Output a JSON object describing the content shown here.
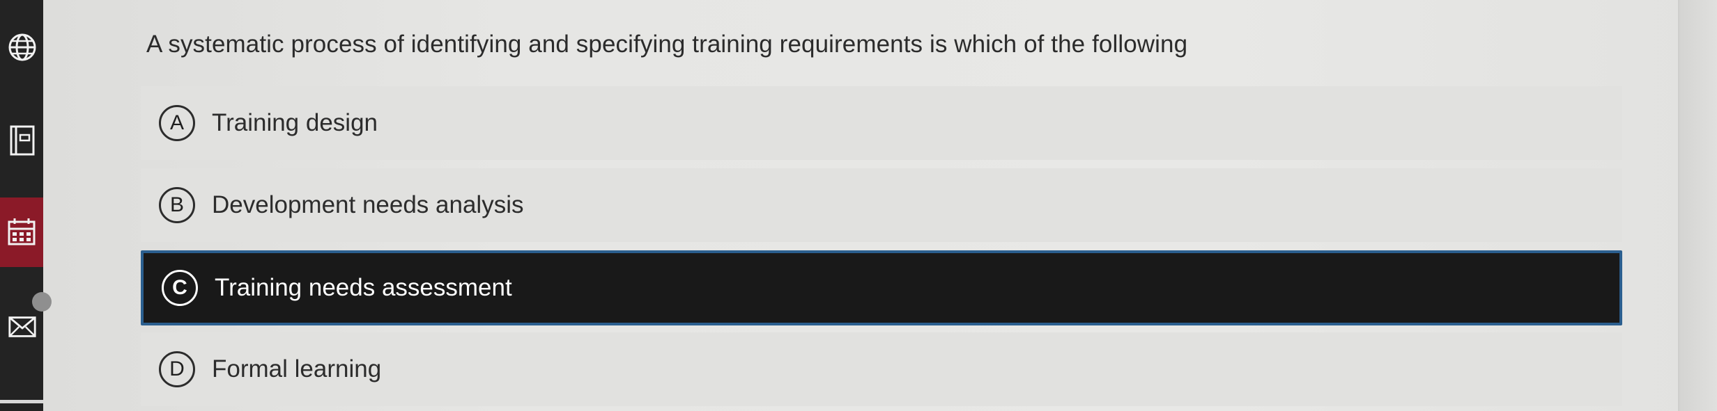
{
  "sidebar": {
    "icons": [
      "globe-icon",
      "book-icon",
      "calendar-icon",
      "mail-icon"
    ],
    "active_color": "#8b1a28"
  },
  "question": {
    "text": "A systematic process of identifying and specifying training requirements is which of the following"
  },
  "options": [
    {
      "letter": "A",
      "label": "Training design",
      "selected": false
    },
    {
      "letter": "B",
      "label": "Development needs analysis",
      "selected": false
    },
    {
      "letter": "C",
      "label": "Training needs assessment",
      "selected": true
    },
    {
      "letter": "D",
      "label": "Formal learning",
      "selected": false
    }
  ],
  "colors": {
    "selected_background": "#191919",
    "selected_border": "#2b5f8f",
    "option_background": "#e1e1df"
  }
}
